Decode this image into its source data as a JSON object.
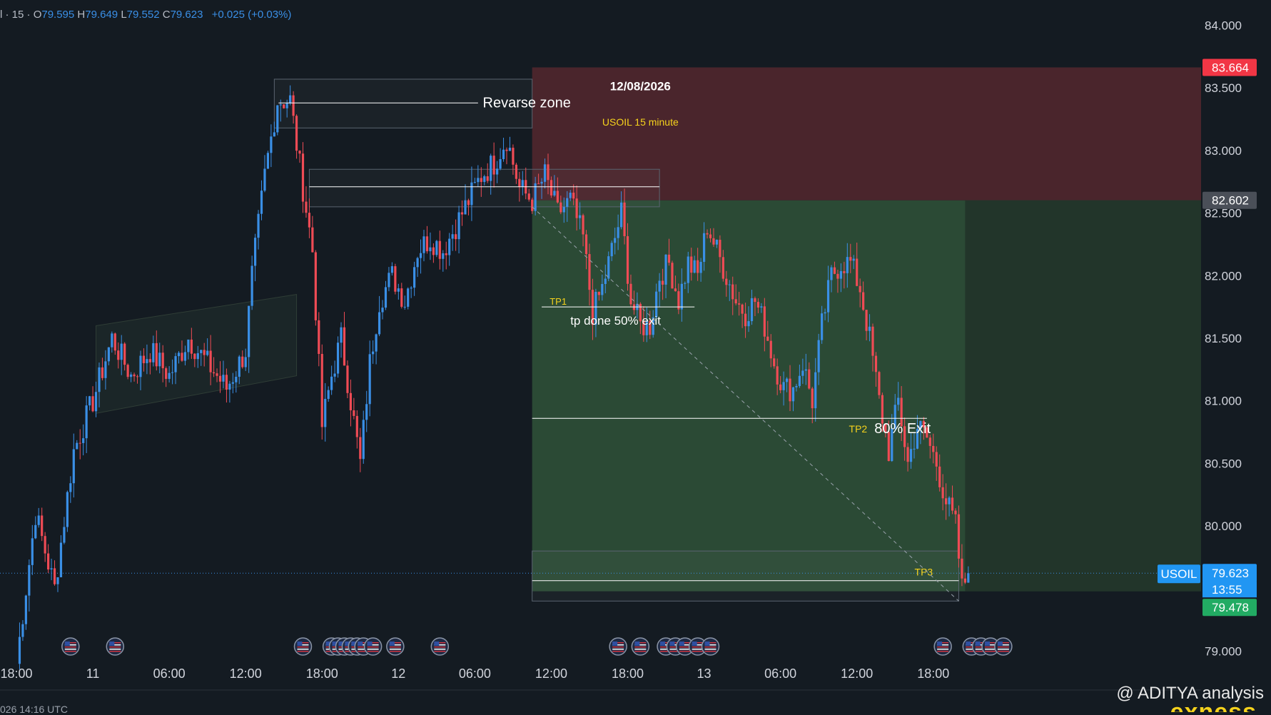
{
  "header": {
    "symbol_prefix": "l · 15 ·",
    "open_label": "O",
    "open": "79.595",
    "high_label": "H",
    "high": "79.649",
    "low_label": "L",
    "low": "79.552",
    "close_label": "C",
    "close": "79.623",
    "change": "+0.025 (+0.03%)"
  },
  "footer": {
    "time_text": "026 14:16 UTC",
    "watermark": "@ ADITYA  analysis",
    "broker_logo": "exness"
  },
  "colors": {
    "background": "#141b22",
    "up_candle": "#3a8fe6",
    "down_candle": "#ef4b55",
    "stop_zone": "#4a252c",
    "target_zone": "#2b4a35",
    "stop_badge": "#f23645",
    "target_badge": "#22ab63",
    "current_badge": "#2196f3"
  },
  "chart_data": {
    "type": "candlestick",
    "instrument": "USOIL",
    "timeframe": "15 minute",
    "y_range": [
      78.9,
      84.1
    ],
    "y_ticks": [
      "84.000",
      "83.500",
      "83.000",
      "82.500",
      "82.000",
      "81.500",
      "81.000",
      "80.500",
      "80.000",
      "79.500",
      "79.000"
    ],
    "x_ticks": [
      {
        "label": "18:00",
        "bar": 0
      },
      {
        "label": "11",
        "bar": 24
      },
      {
        "label": "06:00",
        "bar": 48
      },
      {
        "label": "12:00",
        "bar": 72
      },
      {
        "label": "18:00",
        "bar": 96
      },
      {
        "label": "12",
        "bar": 120
      },
      {
        "label": "06:00",
        "bar": 144
      },
      {
        "label": "12:00",
        "bar": 168
      },
      {
        "label": "18:00",
        "bar": 192
      },
      {
        "label": "13",
        "bar": 216
      },
      {
        "label": "06:00",
        "bar": 240
      },
      {
        "label": "12:00",
        "bar": 264
      },
      {
        "label": "18:00",
        "bar": 288
      }
    ],
    "series_key_points": [
      [
        0,
        78.9
      ],
      [
        6,
        80.1
      ],
      [
        12,
        79.5
      ],
      [
        18,
        80.6
      ],
      [
        24,
        81.0
      ],
      [
        30,
        81.5
      ],
      [
        36,
        81.2
      ],
      [
        42,
        81.4
      ],
      [
        48,
        81.2
      ],
      [
        54,
        81.5
      ],
      [
        60,
        81.3
      ],
      [
        66,
        81.1
      ],
      [
        72,
        81.4
      ],
      [
        74,
        82.0
      ],
      [
        78,
        82.8
      ],
      [
        82,
        83.4
      ],
      [
        86,
        83.4
      ],
      [
        90,
        82.7
      ],
      [
        93,
        82.2
      ],
      [
        96,
        80.8
      ],
      [
        99,
        81.2
      ],
      [
        102,
        81.5
      ],
      [
        105,
        81.0
      ],
      [
        108,
        80.5
      ],
      [
        111,
        81.3
      ],
      [
        114,
        81.8
      ],
      [
        118,
        82.0
      ],
      [
        122,
        81.8
      ],
      [
        126,
        82.2
      ],
      [
        130,
        82.3
      ],
      [
        134,
        82.2
      ],
      [
        138,
        82.4
      ],
      [
        142,
        82.6
      ],
      [
        146,
        82.8
      ],
      [
        150,
        82.9
      ],
      [
        154,
        83.1
      ],
      [
        158,
        82.7
      ],
      [
        162,
        82.6
      ],
      [
        166,
        82.8
      ],
      [
        170,
        82.5
      ],
      [
        174,
        82.6
      ],
      [
        178,
        82.3
      ],
      [
        181,
        81.7
      ],
      [
        184,
        81.9
      ],
      [
        187,
        82.2
      ],
      [
        190,
        82.5
      ],
      [
        193,
        81.8
      ],
      [
        196,
        81.6
      ],
      [
        199,
        81.6
      ],
      [
        202,
        82.0
      ],
      [
        205,
        82.1
      ],
      [
        208,
        81.8
      ],
      [
        211,
        82.1
      ],
      [
        214,
        82.0
      ],
      [
        217,
        82.4
      ],
      [
        220,
        82.2
      ],
      [
        223,
        82.0
      ],
      [
        226,
        81.8
      ],
      [
        229,
        81.7
      ],
      [
        232,
        81.8
      ],
      [
        235,
        81.6
      ],
      [
        238,
        81.3
      ],
      [
        241,
        81.1
      ],
      [
        244,
        81.1
      ],
      [
        247,
        81.3
      ],
      [
        250,
        81.0
      ],
      [
        253,
        81.6
      ],
      [
        256,
        82.0
      ],
      [
        259,
        82.1
      ],
      [
        262,
        82.1
      ],
      [
        265,
        81.9
      ],
      [
        268,
        81.5
      ],
      [
        271,
        81.0
      ],
      [
        274,
        80.6
      ],
      [
        277,
        81.0
      ],
      [
        280,
        80.5
      ],
      [
        283,
        80.8
      ],
      [
        286,
        80.7
      ],
      [
        289,
        80.5
      ],
      [
        292,
        80.2
      ],
      [
        295,
        80.0
      ],
      [
        297,
        79.5
      ],
      [
        299,
        79.62
      ]
    ],
    "price_labels": [
      {
        "price": 83.664,
        "text": "83.664",
        "role": "stop"
      },
      {
        "price": 82.602,
        "text": "82.602",
        "role": "entry"
      },
      {
        "price": 79.623,
        "text": "79.623",
        "role": "current"
      },
      {
        "price": 79.478,
        "text": "79.478",
        "role": "target"
      }
    ],
    "countdown": "13:55",
    "current_label": "USOIL",
    "position": {
      "entry": 82.602,
      "stop": 83.664,
      "target": 79.478,
      "start_bar": 162,
      "end_bar": 298
    },
    "levels": [
      {
        "name": "TP1",
        "price": 81.75
      },
      {
        "name": "TP2",
        "price": 80.86
      },
      {
        "name": "TP3",
        "price": 79.62
      }
    ],
    "zones": [
      {
        "name": "reverse-zone",
        "top": 83.57,
        "bottom": 83.18,
        "start_bar": 81,
        "end_bar": 162
      },
      {
        "name": "supply-zone",
        "top": 82.85,
        "bottom": 82.55,
        "start_bar": 92,
        "end_bar": 202
      },
      {
        "name": "tp3-zone",
        "top": 79.8,
        "bottom": 79.4,
        "start_bar": 162,
        "end_bar": 296
      }
    ],
    "annotations": {
      "date": "12/08/2026",
      "subtitle": "USOIL 15 minute",
      "reverse_zone": "Revarse zone",
      "tp1": "TP1",
      "tp1_note": "tp  done 50% exit",
      "tp2": "TP2",
      "tp2_note": "80% Exit",
      "tp3": "TP3"
    },
    "event_markers_bars": [
      17,
      31,
      90,
      99,
      101,
      103,
      105,
      107,
      109,
      112,
      119,
      133,
      189,
      196,
      204,
      207,
      210,
      214,
      218,
      291,
      300,
      303,
      306,
      310
    ]
  }
}
